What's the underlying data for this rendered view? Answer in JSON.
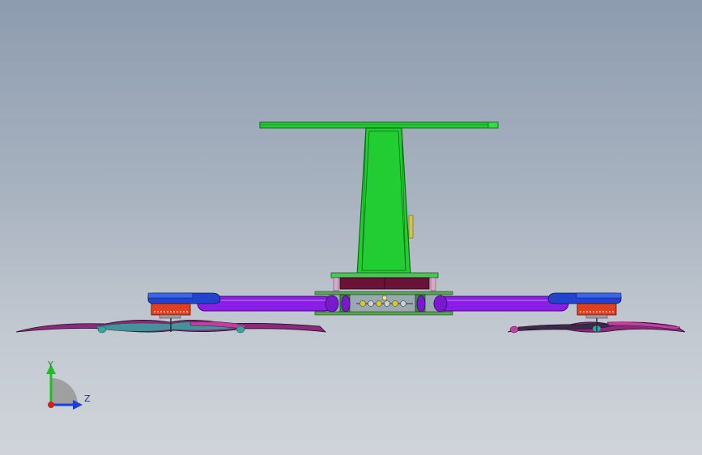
{
  "viewport": {
    "background_top": "#8d9caf",
    "background_bottom": "#d0d4da"
  },
  "model": {
    "colors": {
      "mast": "#22cc33",
      "mast_edge": "#0d6b12",
      "arm": "#8a1ee6",
      "arm_edge": "#3d0a6b",
      "motor_cap": "#2244cc",
      "motor_body": "#e0401f",
      "battery": "#6a1238",
      "frame": "#3a8a3a",
      "propeller_magenta": "#b0308a",
      "propeller_teal": "#3aa5a0",
      "propeller_dark": "#3a2a4a",
      "gear": "#d8c640"
    }
  },
  "triad": {
    "y_label": "Y",
    "z_label": "Z",
    "colors": {
      "y": "#1fbf1f",
      "z": "#1f3fd6",
      "x": "#d41f1f",
      "arc": "#8f8f8f"
    }
  }
}
